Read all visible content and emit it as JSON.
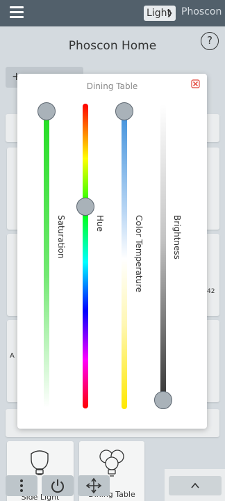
{
  "header": {
    "light_select_value": "Light",
    "app_name": "Phoscon"
  },
  "page": {
    "title": "Phoscon Home",
    "help_symbol": "?",
    "add_symbol": "+",
    "partial_value": "42",
    "partial_letter": "A"
  },
  "dialog": {
    "title": "Dining Table",
    "sliders": [
      {
        "label": "Saturation",
        "level": 1.0
      },
      {
        "label": "Hue",
        "level": 0.67
      },
      {
        "label": "Color Temperature",
        "level": 1.0
      },
      {
        "label": "Brightness",
        "level": 0.0
      }
    ]
  },
  "devices": [
    {
      "label": "Side Light",
      "icon": "bulb-icon"
    },
    {
      "label": "Dining Table",
      "icon": "bulb-group-icon"
    }
  ],
  "icons": {
    "menu": "hamburger-icon",
    "close": "close-x-icon",
    "more": "more-vertical-icon",
    "power": "power-icon",
    "move": "move-arrows-icon",
    "up": "chevron-up-icon"
  },
  "colors": {
    "header_bg": "#52606b",
    "page_bg": "#dde3e8",
    "close_red": "#e2463b"
  }
}
